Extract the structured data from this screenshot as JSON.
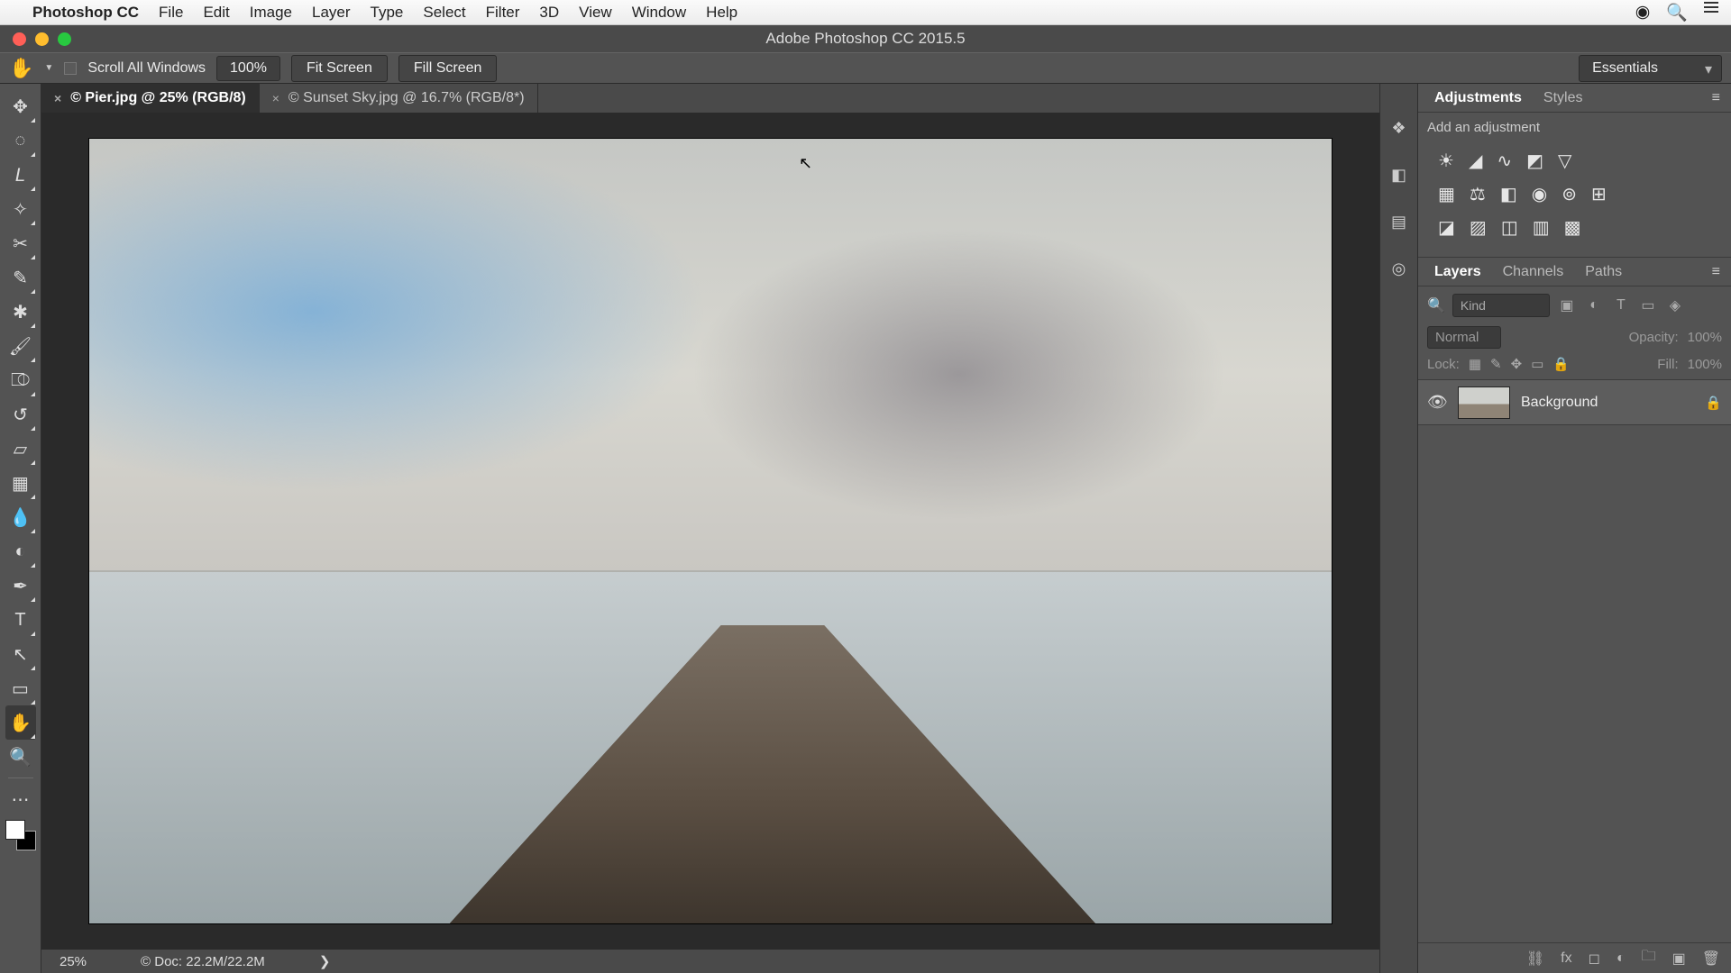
{
  "menubar": {
    "app_name": "Photoshop CC",
    "items": [
      "File",
      "Edit",
      "Image",
      "Layer",
      "Type",
      "Select",
      "Filter",
      "3D",
      "View",
      "Window",
      "Help"
    ]
  },
  "window": {
    "title": "Adobe Photoshop CC 2015.5"
  },
  "options": {
    "scroll_all": "Scroll All Windows",
    "zoom": "100%",
    "fit": "Fit Screen",
    "fill": "Fill Screen",
    "workspace": "Essentials"
  },
  "tabs": [
    {
      "label": "© Pier.jpg @ 25% (RGB/8)",
      "active": true
    },
    {
      "label": "© Sunset Sky.jpg @ 16.7% (RGB/8*)",
      "active": false
    }
  ],
  "status": {
    "zoom": "25%",
    "doc": "© Doc: 22.2M/22.2M",
    "arrow": "❯"
  },
  "adjustments": {
    "tab1": "Adjustments",
    "tab2": "Styles",
    "label": "Add an adjustment"
  },
  "layers_panel": {
    "tab1": "Layers",
    "tab2": "Channels",
    "tab3": "Paths",
    "kind": "Kind",
    "blend": "Normal",
    "opacity_label": "Opacity:",
    "opacity_val": "100%",
    "lock_label": "Lock:",
    "fill_label": "Fill:",
    "fill_val": "100%"
  },
  "layers": [
    {
      "name": "Background",
      "locked": true
    }
  ]
}
